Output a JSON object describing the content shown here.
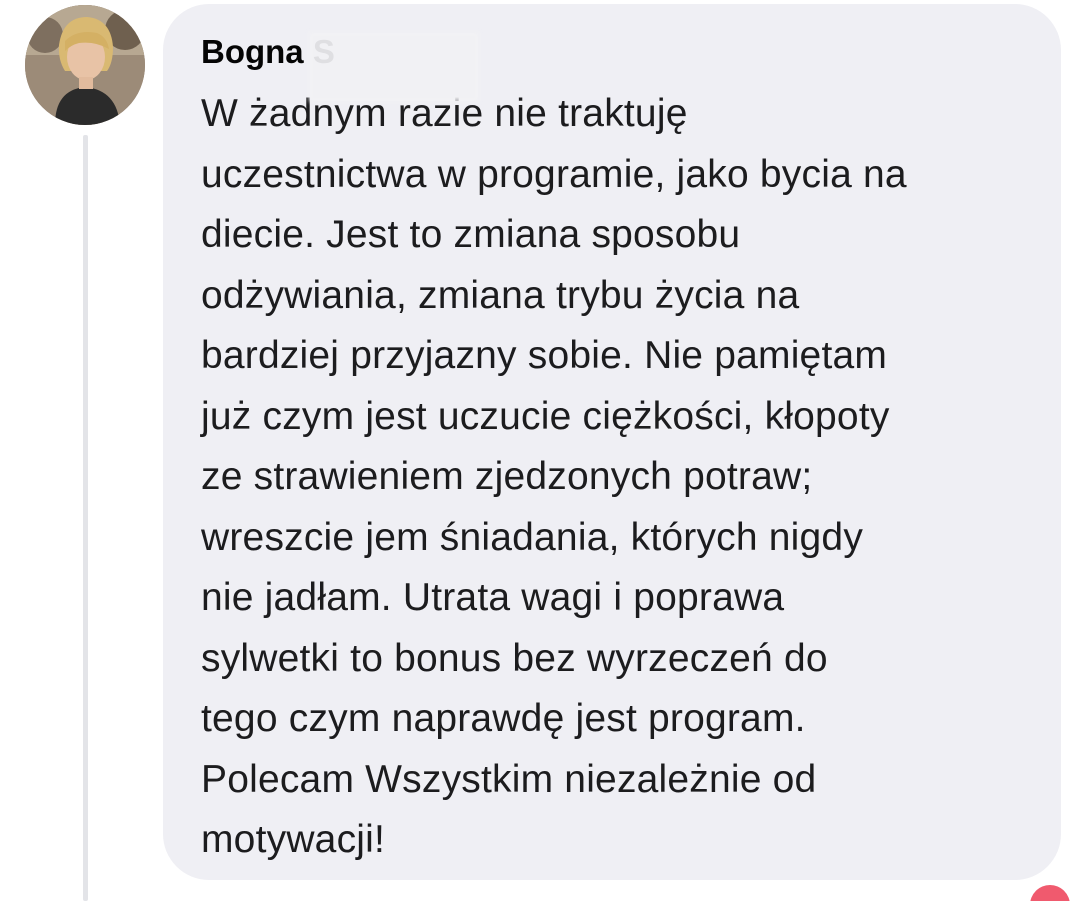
{
  "comment": {
    "author_name": "Bogna S",
    "lines": [
      "W żadnym razie nie traktuję",
      "uczestnictwa w programie, jako bycia na",
      "diecie. Jest to zmiana sposobu",
      "odżywiania, zmiana trybu życia na",
      "bardziej przyjazny sobie. Nie pamiętam",
      "już czym jest uczucie ciężkości, kłopoty",
      "ze strawieniem zjedzonych potraw;",
      "wreszcie jem śniadania, których nigdy",
      "nie jadłam. Utrata wagi i poprawa",
      "sylwetki to bonus bez wyrzeczeń do",
      "tego czym naprawdę jest program.",
      "Polecam Wszystkim niezależnie od",
      "motywacji!"
    ]
  },
  "colors": {
    "bubble_background": "#efeff4",
    "text": "#1c1c1e",
    "thread_line": "#e3e4e8",
    "reaction": "#f05a6e"
  },
  "icons": {
    "avatar": "user-photo",
    "reaction": "heart-reaction-icon"
  }
}
